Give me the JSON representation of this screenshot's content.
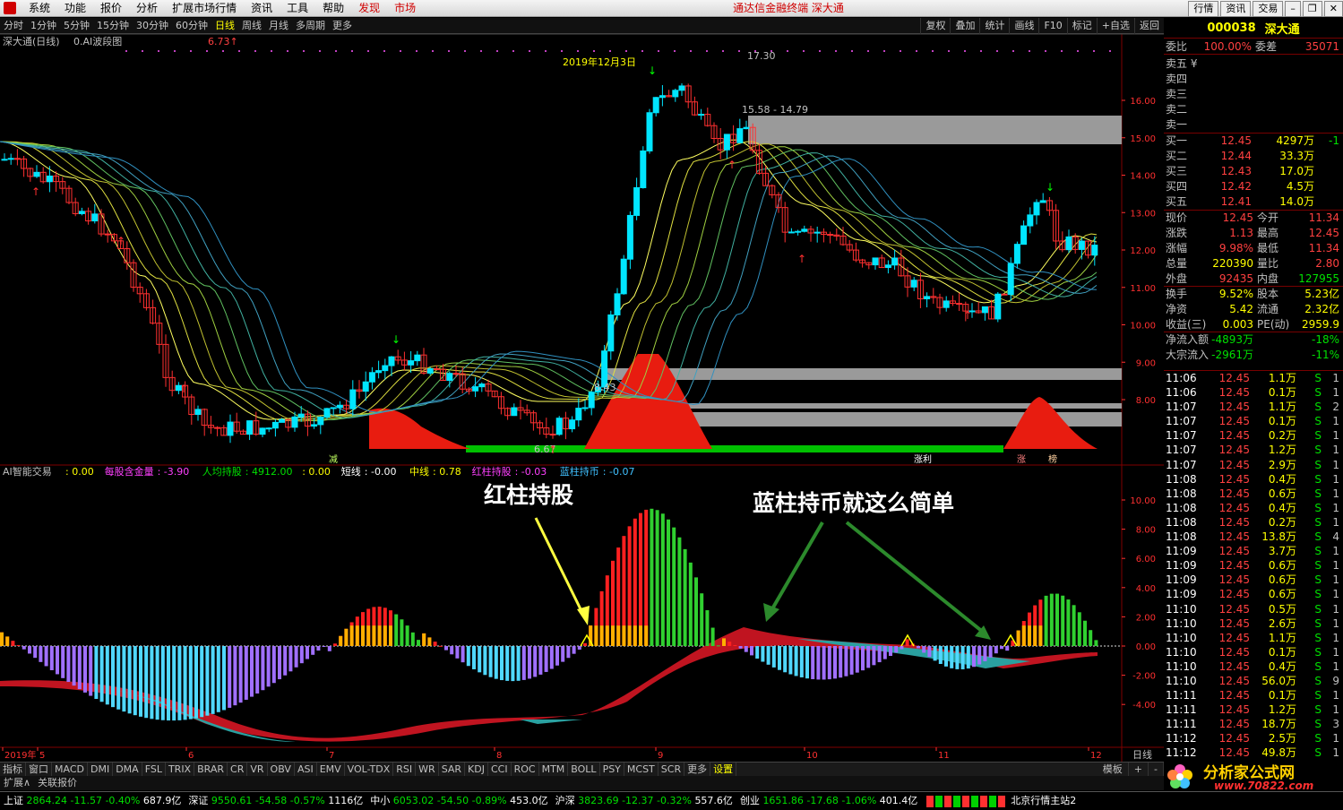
{
  "menu": {
    "items": [
      "系统",
      "功能",
      "报价",
      "分析",
      "扩展市场行情",
      "资讯",
      "工具",
      "帮助"
    ],
    "hot": [
      "发现",
      "市场"
    ]
  },
  "window_title": "通达信金融终端 深大通",
  "top_buttons": [
    "行情",
    "资讯",
    "交易"
  ],
  "periods": [
    "分时",
    "1分钟",
    "5分钟",
    "15分钟",
    "30分钟",
    "60分钟",
    "日线",
    "周线",
    "月线",
    "多周期",
    "更多"
  ],
  "active_period": "日线",
  "right_tools": [
    "复权",
    "叠加",
    "统计",
    "画线",
    "F10",
    "标记",
    "+自选",
    "返回"
  ],
  "main_title": "深大通(日线)",
  "main_indicator": "0.AI波段图",
  "main_value": "6.73",
  "ann": {
    "date": "2019年12月3日",
    "high": "17.30",
    "range": "15.58 - 14.79",
    "lev1": "8.43",
    "low": "6.67"
  },
  "price_axis": [
    "16.00",
    "15.00",
    "14.00",
    "13.00",
    "12.00",
    "11.00",
    "10.00",
    "9.00",
    "8.00"
  ],
  "signals": {
    "jian": "减",
    "libi": "涨利",
    "zhang": "涨",
    "bang": "榜"
  },
  "sub_legend": [
    {
      "t": "AI智能交易",
      "c": "#c0c0c0"
    },
    {
      "t": ": 0.00",
      "c": "#ffff00"
    },
    {
      "t": "每股含金量",
      "c": "#ff40ff"
    },
    {
      "t": ": -3.90",
      "c": "#ff40ff"
    },
    {
      "t": "人均持股",
      "c": "#00e000"
    },
    {
      "t": ": 4912.00",
      "c": "#00e000"
    },
    {
      "t": ": 0.00",
      "c": "#ffff00"
    },
    {
      "t": "短线",
      "c": "#fff"
    },
    {
      "t": ": -0.00",
      "c": "#fff"
    },
    {
      "t": "中线",
      "c": "#ffff00"
    },
    {
      "t": ": 0.78",
      "c": "#ffff00"
    },
    {
      "t": "红柱持股",
      "c": "#ff40ff"
    },
    {
      "t": ": -0.03",
      "c": "#ff40ff"
    },
    {
      "t": "蓝柱持币",
      "c": "#40c0ff"
    },
    {
      "t": ": -0.07",
      "c": "#40c0ff"
    }
  ],
  "callouts": {
    "left": "红柱持股",
    "right": "蓝柱持币就这么简单"
  },
  "sub_axis": [
    "10.00",
    "8.00",
    "6.00",
    "4.00",
    "2.00",
    "0.00",
    "-2.00",
    "-4.00"
  ],
  "date_axis": [
    "2019年",
    "5",
    "6",
    "7",
    "8",
    "9",
    "10",
    "11",
    "12"
  ],
  "date_axis_end": "日线",
  "ticker": {
    "code": "000038",
    "name": "深大通"
  },
  "webi": {
    "l": "委比",
    "v": "100.00%",
    "l2": "委差",
    "v2": "35071"
  },
  "sells": [
    "卖五 ¥",
    "卖四",
    "卖三",
    "卖二",
    "卖一"
  ],
  "buys": [
    {
      "l": "买一",
      "p": "12.45",
      "v": "4297万",
      "d": "-1"
    },
    {
      "l": "买二",
      "p": "12.44",
      "v": "33.3万",
      "d": ""
    },
    {
      "l": "买三",
      "p": "12.43",
      "v": "17.0万",
      "d": ""
    },
    {
      "l": "买四",
      "p": "12.42",
      "v": "4.5万",
      "d": ""
    },
    {
      "l": "买五",
      "p": "12.41",
      "v": "14.0万",
      "d": ""
    }
  ],
  "stats": [
    {
      "l": "现价",
      "v": "12.45",
      "c": "#ff4040",
      "l2": "今开",
      "v2": "11.34",
      "c2": "#ff4040"
    },
    {
      "l": "涨跌",
      "v": "1.13",
      "c": "#ff4040",
      "l2": "最高",
      "v2": "12.45",
      "c2": "#ff4040"
    },
    {
      "l": "涨幅",
      "v": "9.98%",
      "c": "#ff4040",
      "l2": "最低",
      "v2": "11.34",
      "c2": "#ff4040"
    },
    {
      "l": "总量",
      "v": "220390",
      "c": "#ffff00",
      "l2": "量比",
      "v2": "2.80",
      "c2": "#ff4040"
    },
    {
      "l": "外盘",
      "v": "92435",
      "c": "#ff4040",
      "l2": "内盘",
      "v2": "127955",
      "c2": "#00e000"
    },
    {
      "l": "换手",
      "v": "9.52%",
      "c": "#ffff00",
      "l2": "股本",
      "v2": "5.23亿",
      "c2": "#ffff00"
    },
    {
      "l": "净资",
      "v": "5.42",
      "c": "#ffff00",
      "l2": "流通",
      "v2": "2.32亿",
      "c2": "#ffff00"
    },
    {
      "l": "收益(三)",
      "v": "0.003",
      "c": "#ffff00",
      "l2": "PE(动)",
      "v2": "2959.9",
      "c2": "#ffff00"
    },
    {
      "l": "净流入额",
      "v": "-4893万",
      "c": "#00e000",
      "l2": "",
      "v2": "-18%",
      "c2": "#00e000"
    },
    {
      "l": "大宗流入",
      "v": "-2961万",
      "c": "#00e000",
      "l2": "",
      "v2": "-11%",
      "c2": "#00e000"
    }
  ],
  "ticks": [
    [
      "11:06",
      "12.45",
      "1.1万",
      "S",
      "1"
    ],
    [
      "11:06",
      "12.45",
      "0.1万",
      "S",
      "1"
    ],
    [
      "11:07",
      "12.45",
      "1.1万",
      "S",
      "2"
    ],
    [
      "11:07",
      "12.45",
      "0.1万",
      "S",
      "1"
    ],
    [
      "11:07",
      "12.45",
      "0.2万",
      "S",
      "1"
    ],
    [
      "11:07",
      "12.45",
      "1.2万",
      "S",
      "1"
    ],
    [
      "11:07",
      "12.45",
      "2.9万",
      "S",
      "1"
    ],
    [
      "11:08",
      "12.45",
      "0.4万",
      "S",
      "1"
    ],
    [
      "11:08",
      "12.45",
      "0.6万",
      "S",
      "1"
    ],
    [
      "11:08",
      "12.45",
      "0.4万",
      "S",
      "1"
    ],
    [
      "11:08",
      "12.45",
      "0.2万",
      "S",
      "1"
    ],
    [
      "11:08",
      "12.45",
      "13.8万",
      "S",
      "4"
    ],
    [
      "11:09",
      "12.45",
      "3.7万",
      "S",
      "1"
    ],
    [
      "11:09",
      "12.45",
      "0.6万",
      "S",
      "1"
    ],
    [
      "11:09",
      "12.45",
      "0.6万",
      "S",
      "1"
    ],
    [
      "11:09",
      "12.45",
      "0.6万",
      "S",
      "1"
    ],
    [
      "11:10",
      "12.45",
      "0.5万",
      "S",
      "1"
    ],
    [
      "11:10",
      "12.45",
      "2.6万",
      "S",
      "1"
    ],
    [
      "11:10",
      "12.45",
      "1.1万",
      "S",
      "1"
    ],
    [
      "11:10",
      "12.45",
      "0.1万",
      "S",
      "1"
    ],
    [
      "11:10",
      "12.45",
      "0.4万",
      "S",
      "1"
    ],
    [
      "11:10",
      "12.45",
      "56.0万",
      "S",
      "9"
    ],
    [
      "11:11",
      "12.45",
      "0.1万",
      "S",
      "1"
    ],
    [
      "11:11",
      "12.45",
      "1.2万",
      "S",
      "1"
    ],
    [
      "11:11",
      "12.45",
      "18.7万",
      "S",
      "3"
    ],
    [
      "11:12",
      "12.45",
      "2.5万",
      "S",
      "1"
    ],
    [
      "11:12",
      "12.45",
      "49.8万",
      "S",
      "1"
    ]
  ],
  "bottom_tabs": [
    "指标",
    "窗口",
    "MACD",
    "DMI",
    "DMA",
    "FSL",
    "TRIX",
    "BRAR",
    "CR",
    "VR",
    "OBV",
    "ASI",
    "EMV",
    "VOL-TDX",
    "RSI",
    "WR",
    "SAR",
    "KDJ",
    "CCI",
    "ROC",
    "MTM",
    "BOLL",
    "PSY",
    "MCST",
    "SCR",
    "更多",
    "设置"
  ],
  "bottom_right": [
    "模板",
    "+",
    "-"
  ],
  "sub_tabs": [
    "扩展∧",
    "关联报价"
  ],
  "indices": [
    {
      "n": "上证",
      "v": "2864.24",
      "d": "-11.57",
      "p": "-0.40%",
      "a": "687.9亿"
    },
    {
      "n": "深证",
      "v": "9550.61",
      "d": "-54.58",
      "p": "-0.57%",
      "a": "1116亿"
    },
    {
      "n": "中小",
      "v": "6053.02",
      "d": "-54.50",
      "p": "-0.89%",
      "a": "453.0亿"
    },
    {
      "n": "沪深",
      "v": "3823.69",
      "d": "-12.37",
      "p": "-0.32%",
      "a": "557.6亿"
    },
    {
      "n": "创业",
      "v": "1651.86",
      "d": "-17.68",
      "p": "-1.06%",
      "a": "401.4亿"
    }
  ],
  "status_right": "北京行情主站2",
  "logo": {
    "name": "分析家公式网",
    "url": "www.70822.com"
  },
  "colors": {
    "up": "#ff3030",
    "down": "#00e5ff",
    "bg": "#000000",
    "accent": "#ffff00"
  }
}
